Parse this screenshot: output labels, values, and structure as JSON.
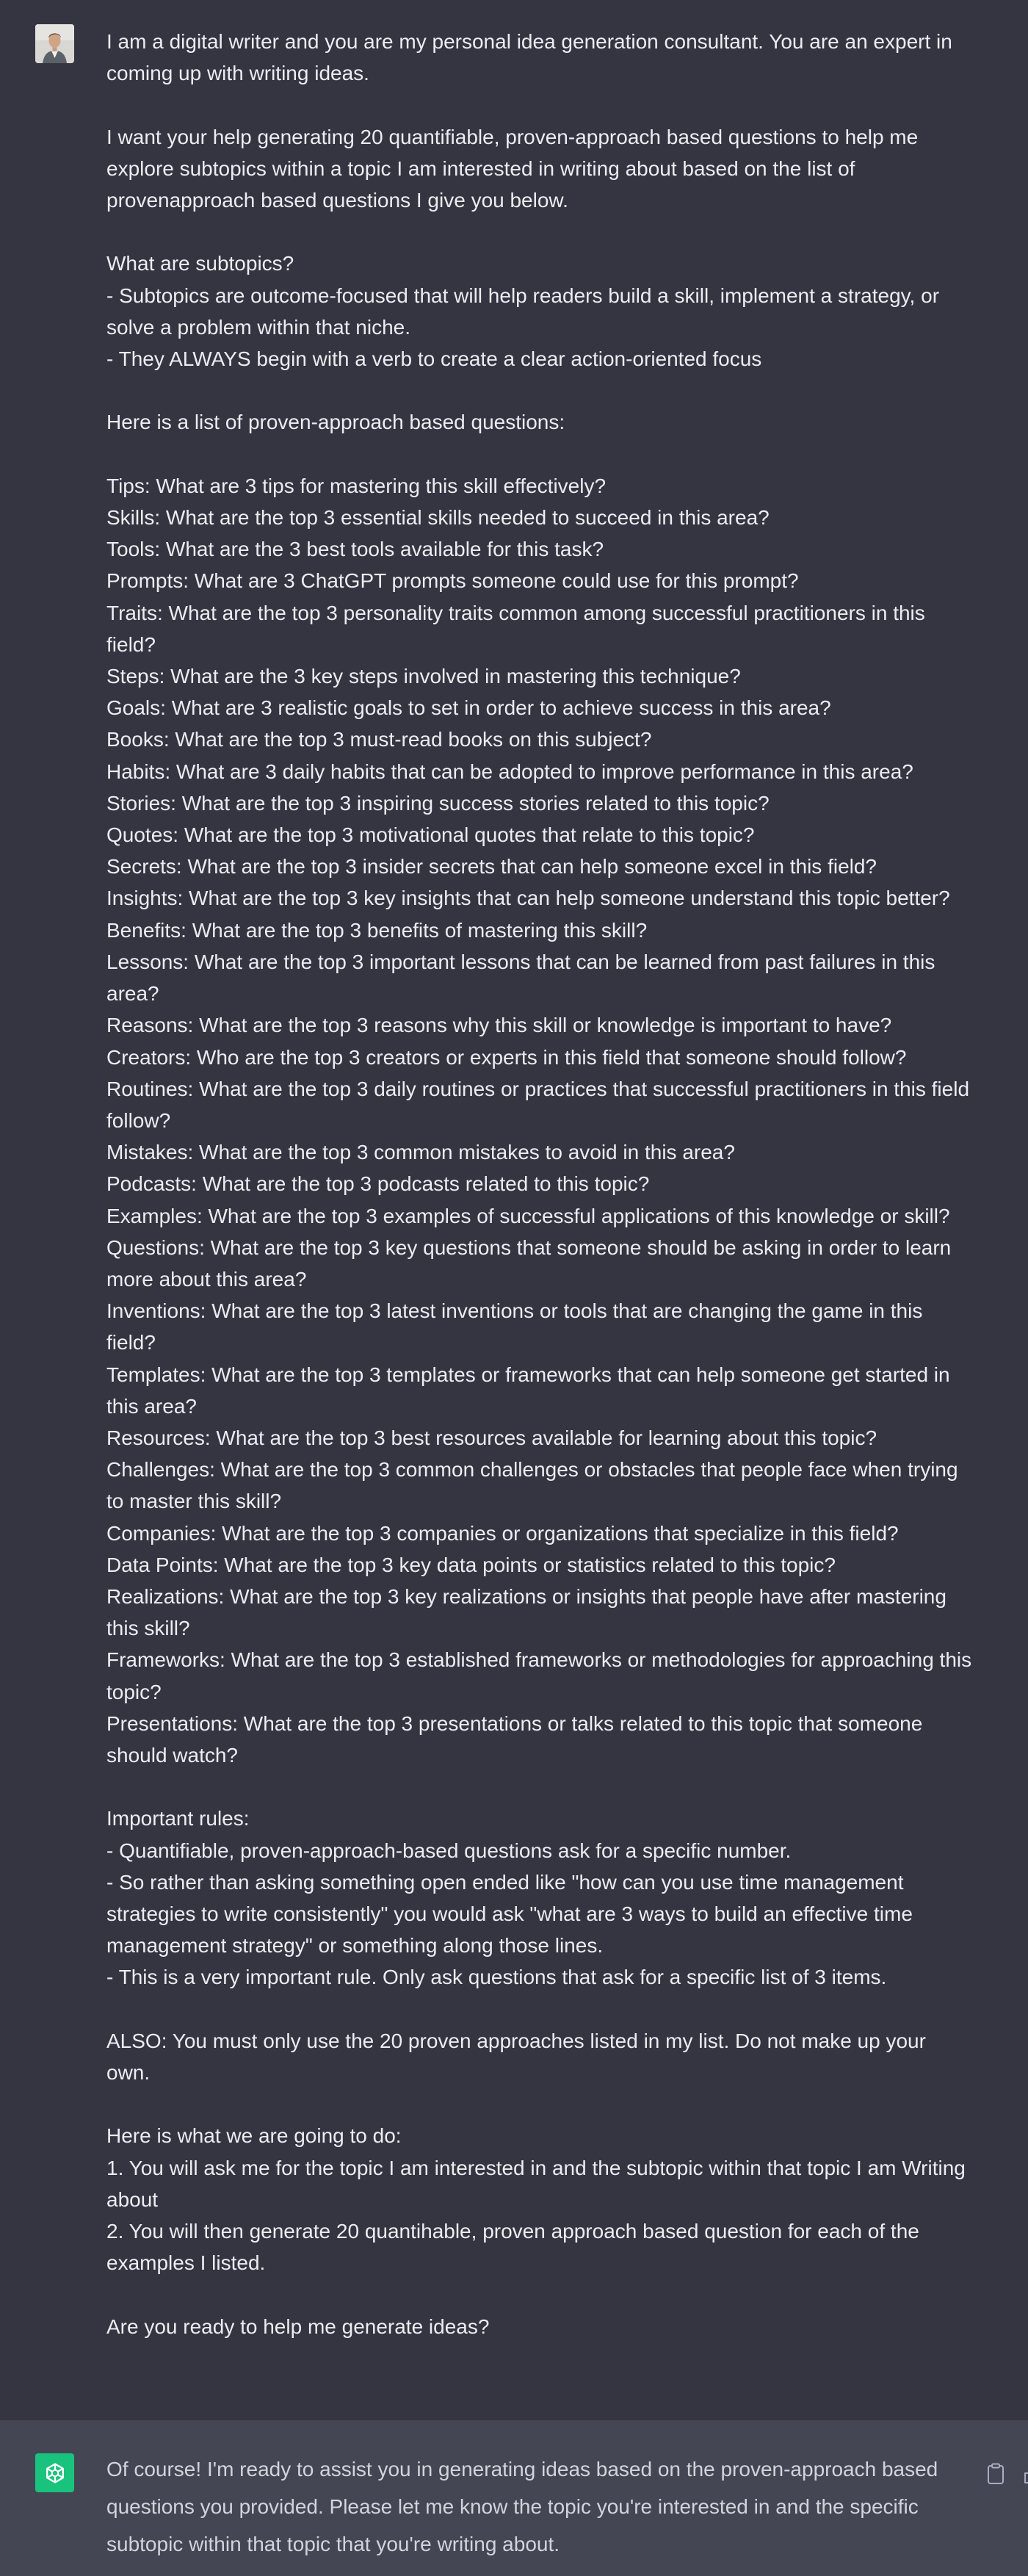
{
  "conversation": {
    "user_message": {
      "avatar_icon": "user-photo-avatar",
      "text": "I am a digital writer and you are my personal idea generation consultant. You are an expert in coming up with writing ideas.\n\nI want your help generating 20 quantifiable, proven-approach based questions to help me explore subtopics within a topic I am interested in writing about based on the list of provenapproach based questions I give you below.\n\nWhat are subtopics?\n- Subtopics are outcome-focused that will help readers build a skill, implement a strategy, or solve a problem within that niche.\n- They ALWAYS begin with a verb to create a clear action-oriented focus\n\nHere is a list of proven-approach based questions:\n\nTips: What are 3 tips for mastering this skill effectively?\nSkills: What are the top 3 essential skills needed to succeed in this area?\nTools: What are the 3 best tools available for this task?\nPrompts: What are 3 ChatGPT prompts someone could use for this prompt?\nTraits: What are the top 3 personality traits common among successful practitioners in this field?\nSteps: What are the 3 key steps involved in mastering this technique?\nGoals: What are 3 realistic goals to set in order to achieve success in this area?\nBooks: What are the top 3 must-read books on this subject?\nHabits: What are 3 daily habits that can be adopted to improve performance in this area?\nStories: What are the top 3 inspiring success stories related to this topic?\nQuotes: What are the top 3 motivational quotes that relate to this topic?\nSecrets: What are the top 3 insider secrets that can help someone excel in this field?\nInsights: What are the top 3 key insights that can help someone understand this topic better?\nBenefits: What are the top 3 benefits of mastering this skill?\nLessons: What are the top 3 important lessons that can be learned from past failures in this area?\nReasons: What are the top 3 reasons why this skill or knowledge is important to have?\nCreators: Who are the top 3 creators or experts in this field that someone should follow?\nRoutines: What are the top 3 daily routines or practices that successful practitioners in this field follow?\nMistakes: What are the top 3 common mistakes to avoid in this area?\nPodcasts: What are the top 3 podcasts related to this topic?\nExamples: What are the top 3 examples of successful applications of this knowledge or skill?\nQuestions: What are the top 3 key questions that someone should be asking in order to learn more about this area?\nInventions: What are the top 3 latest inventions or tools that are changing the game in this field?\nTemplates: What are the top 3 templates or frameworks that can help someone get started in this area?\nResources: What are the top 3 best resources available for learning about this topic?\nChallenges: What are the top 3 common challenges or obstacles that people face when trying to master this skill?\nCompanies: What are the top 3 companies or organizations that specialize in this field?\nData Points: What are the top 3 key data points or statistics related to this topic?\nRealizations: What are the top 3 key realizations or insights that people have after mastering this skill?\nFrameworks: What are the top 3 established frameworks or methodologies for approaching this topic?\nPresentations: What are the top 3 presentations or talks related to this topic that someone should watch?\n\nImportant rules:\n- Quantifiable, proven-approach-based questions ask for a specific number.\n- So rather than asking something open ended like \"how can you use time management strategies to write consistently\" you would ask \"what are 3 ways to build an effective time management strategy\" or something along those lines.\n- This is a very important rule. Only ask questions that ask for a specific list of 3 items.\n\nALSO: You must only use the 20 proven approaches listed in my list. Do not make up your own.\n\nHere is what we are going to do:\n1. You will ask me for the topic I am interested in and the subtopic within that topic I am Writing about\n2. You will then generate 20 quantihable, proven approach based question for each of the examples I listed.\n\nAre you ready to help me generate ideas?"
    },
    "assistant_message": {
      "avatar_icon": "openai-logo-icon",
      "text": "Of course! I'm ready to assist you in generating ideas based on the proven-approach based questions you provided. Please let me know the topic you're interested in and the specific subtopic within that topic that you're writing about.",
      "actions": [
        "copy-icon",
        "thumbs-up-icon"
      ]
    }
  },
  "colors": {
    "page_background": "#343541",
    "assistant_background": "#444654",
    "user_text": "#ececf1",
    "assistant_text": "#d1d5db",
    "assistant_avatar": "#19c37d",
    "icon_muted": "#acacbe"
  }
}
